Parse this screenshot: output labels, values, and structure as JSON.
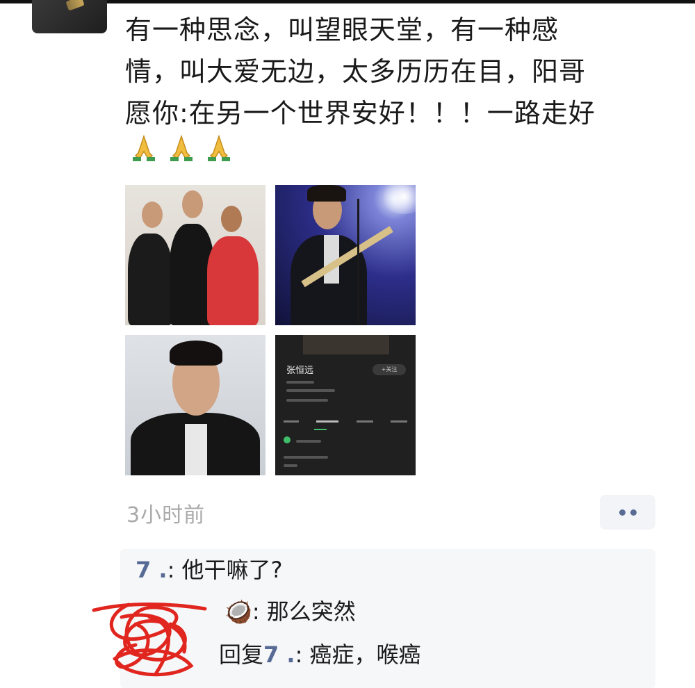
{
  "post": {
    "text_lines": [
      "有一种思念，叫望眼天堂，有一种感",
      "情，叫大爱无边，太多历历在目，阳哥",
      "愿你:在另一个世界安好！！！一路走好"
    ],
    "emojis": [
      "pray-icon",
      "pray-icon",
      "pray-icon"
    ],
    "photo_app": {
      "artist_name": "张恒远",
      "follow_label": "+关注"
    },
    "time": "3小时前"
  },
  "comments": [
    {
      "author": "7 .",
      "sep": ": ",
      "text": "他干嘛了?"
    },
    {
      "author": "",
      "emoji": "🥥",
      "sep": ": ",
      "text": "那么突然"
    },
    {
      "author": "",
      "reply_word": "回复",
      "reply_to": "7 .",
      "sep": ": ",
      "text": "癌症，喉癌"
    }
  ],
  "colors": {
    "link_blue": "#576b95",
    "time_gray": "#a9a9a9",
    "comment_bg": "#f6f7f9",
    "scribble_red": "#e0261f"
  }
}
